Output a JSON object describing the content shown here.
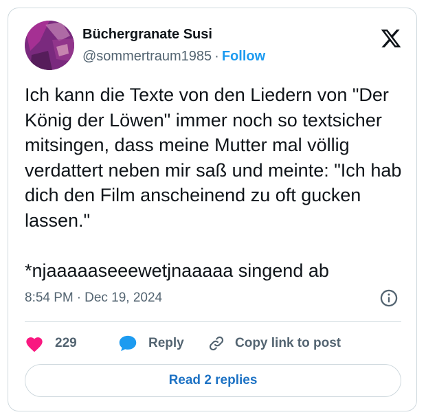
{
  "author": {
    "display_name": "Büchergranate Susi",
    "handle": "@sommertraum1985",
    "separator": "·",
    "follow_label": "Follow"
  },
  "tweet": {
    "text": "Ich kann die Texte von den Liedern von \"Der König der Löwen\" immer noch so textsicher mitsingen, dass meine Mutter mal völlig verdattert neben mir saß und meinte: \"Ich hab dich den Film anscheinend zu oft gucken lassen.\"\n\n*njaaaaaseeewetjnaaaaa singend ab",
    "time": "8:54 PM",
    "separator": "·",
    "date": "Dec 19, 2024"
  },
  "actions": {
    "like_count": "229",
    "reply_label": "Reply",
    "copy_link_label": "Copy link to post"
  },
  "read_replies_label": "Read 2 replies",
  "icons": {
    "logo": "x-logo-icon",
    "info": "info-icon",
    "like": "heart-icon",
    "reply": "speech-bubble-icon",
    "copy": "link-icon"
  },
  "colors": {
    "accent": "#1d9bf0",
    "like": "#f91880",
    "reply_bubble": "#1d9bf0",
    "read_replies_text": "#1d72c4",
    "text_primary": "#0f1419",
    "text_secondary": "#536471",
    "border": "#cfd9de"
  }
}
